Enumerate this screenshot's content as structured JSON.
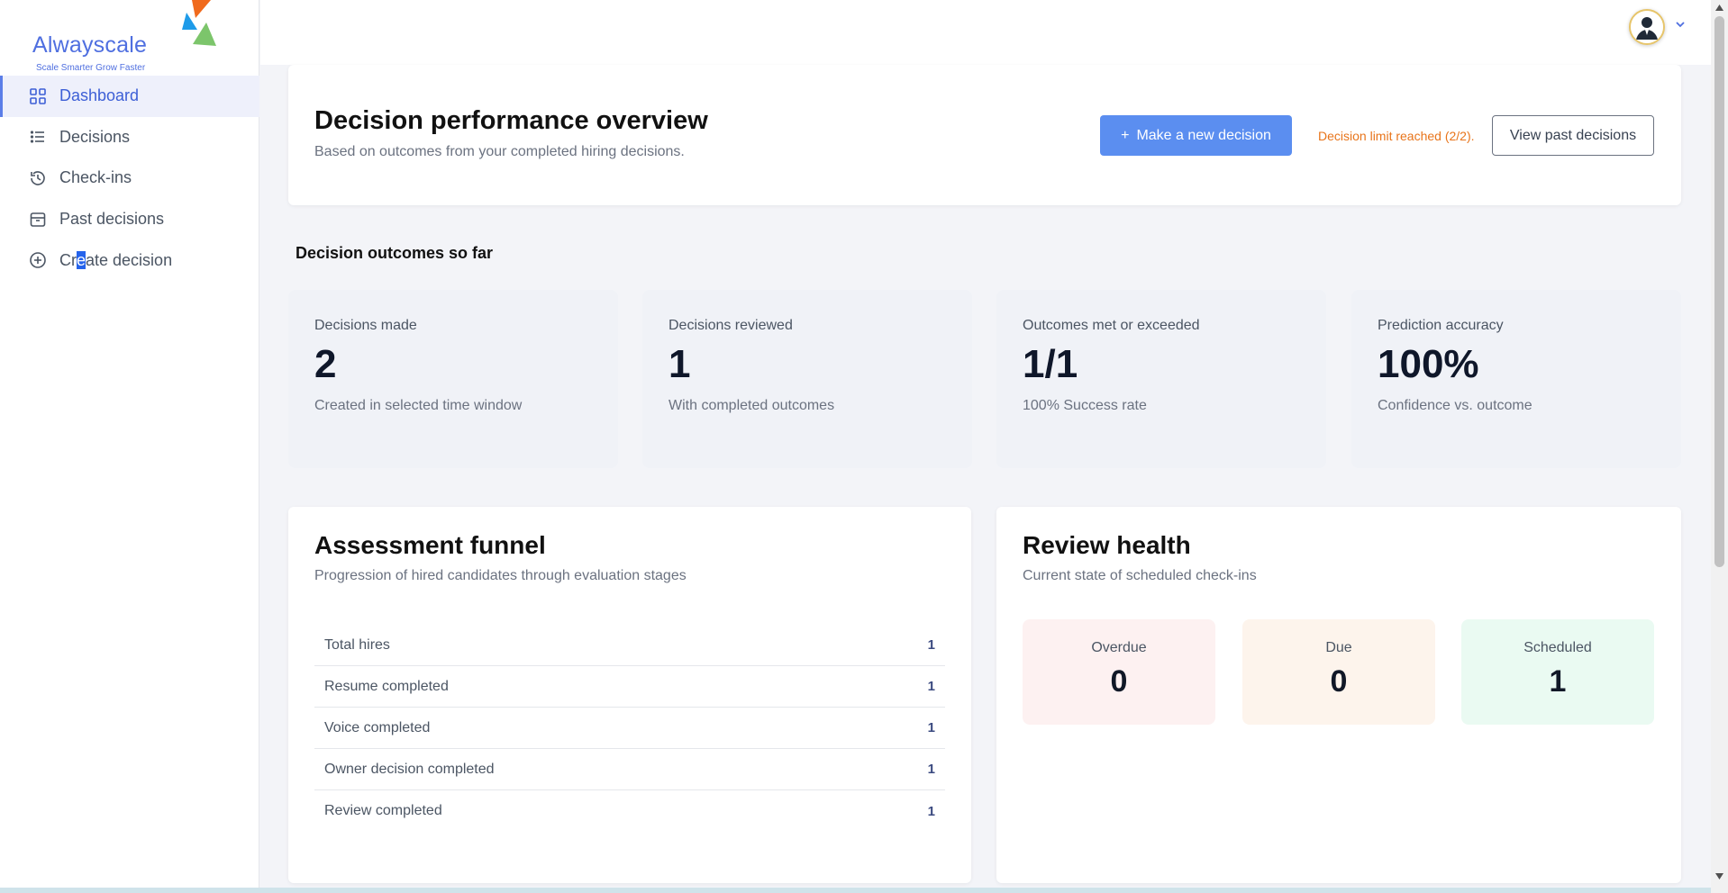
{
  "brand": {
    "name": "Alwayscale",
    "tagline": "Scale Smarter Grow Faster",
    "colors": {
      "primary": "#4f6fe0",
      "orange": "#f06a1d",
      "blue": "#1e9be9",
      "green": "#7cc56b"
    }
  },
  "sidebar": {
    "items": [
      {
        "label": "Dashboard",
        "icon": "grid-icon",
        "active": true
      },
      {
        "label": "Decisions",
        "icon": "list-icon",
        "active": false
      },
      {
        "label": "Check-ins",
        "icon": "history-icon",
        "active": false
      },
      {
        "label": "Past decisions",
        "icon": "archive-icon",
        "active": false
      },
      {
        "label": "Create decision",
        "icon": "plus-circle-icon",
        "active": false
      }
    ],
    "create_parts": [
      "Cr",
      "e",
      "ate decision"
    ]
  },
  "topbar": {
    "avatar_icon": "user-avatar-icon",
    "menu_icon": "chevron-down-icon"
  },
  "overview": {
    "title": "Decision performance overview",
    "subtitle": "Based on outcomes from your completed hiring decisions.",
    "new_button_icon": "+",
    "new_button": "Make a new decision",
    "limit_text": "Decision limit reached (2/2).",
    "past_button": "View past decisions",
    "colors": {
      "primary_button": "#5b8ef0",
      "warning": "#e8741a"
    }
  },
  "outcomes": {
    "title": "Decision outcomes so far",
    "stats": [
      {
        "label": "Decisions made",
        "value": "2",
        "sub": "Created in selected time window"
      },
      {
        "label": "Decisions reviewed",
        "value": "1",
        "sub": "With completed outcomes"
      },
      {
        "label": "Outcomes met or exceeded",
        "value": "1/1",
        "sub": "100% Success rate"
      },
      {
        "label": "Prediction accuracy",
        "value": "100%",
        "sub": "Confidence vs. outcome"
      }
    ]
  },
  "funnel": {
    "title": "Assessment funnel",
    "subtitle": "Progression of hired candidates through evaluation stages",
    "rows": [
      {
        "label": "Total hires",
        "value": "1"
      },
      {
        "label": "Resume completed",
        "value": "1"
      },
      {
        "label": "Voice completed",
        "value": "1"
      },
      {
        "label": "Owner decision completed",
        "value": "1"
      },
      {
        "label": "Review completed",
        "value": "1"
      }
    ]
  },
  "health": {
    "title": "Review health",
    "subtitle": "Current state of scheduled check-ins",
    "boxes": [
      {
        "label": "Overdue",
        "value": "0",
        "color": "#fdf1f1"
      },
      {
        "label": "Due",
        "value": "0",
        "color": "#fdf4ec"
      },
      {
        "label": "Scheduled",
        "value": "1",
        "color": "#eafaf2"
      }
    ]
  }
}
